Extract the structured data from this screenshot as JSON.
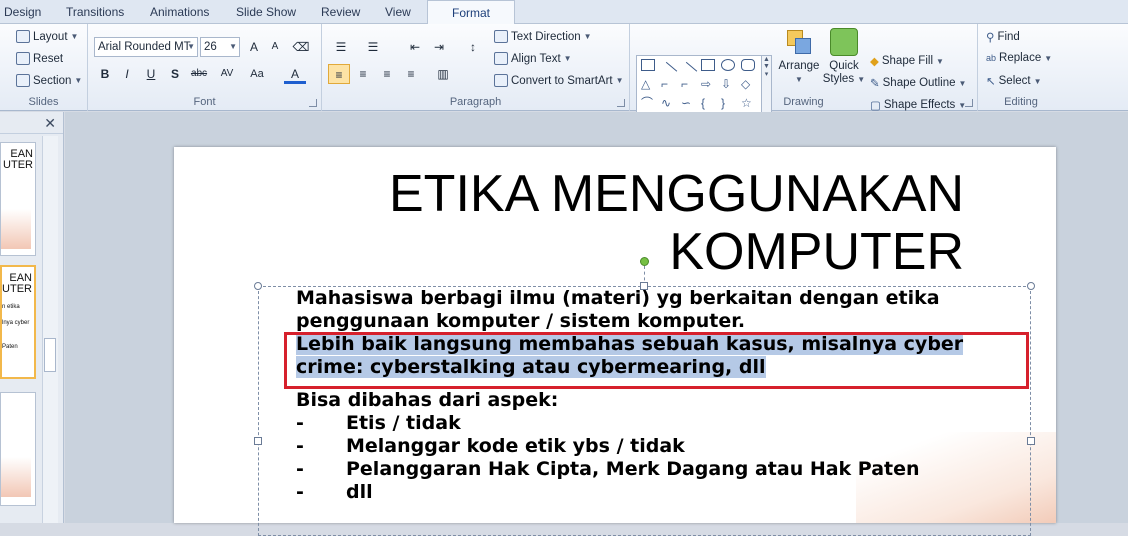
{
  "tabs": [
    "Design",
    "Transitions",
    "Animations",
    "Slide Show",
    "Review",
    "View",
    "Format"
  ],
  "active_tab": "Format",
  "ribbon": {
    "slides": {
      "label": "Slides",
      "layout": "Layout",
      "reset": "Reset",
      "section": "Section"
    },
    "font": {
      "label": "Font",
      "font_name": "Arial Rounded MT",
      "font_size": "26"
    },
    "paragraph": {
      "label": "Paragraph",
      "text_direction": "Text Direction",
      "align_text": "Align Text",
      "convert_smartart": "Convert to SmartArt"
    },
    "drawing": {
      "label": "Drawing",
      "arrange": "Arrange",
      "quick_styles_1": "Quick",
      "quick_styles_2": "Styles",
      "shape_fill": "Shape Fill",
      "shape_outline": "Shape Outline",
      "shape_effects": "Shape Effects"
    },
    "editing": {
      "label": "Editing",
      "find": "Find",
      "replace": "Replace",
      "select": "Select"
    }
  },
  "thumbs": {
    "t1_a": "EAN",
    "t1_b": "UTER",
    "t2_a": "EAN",
    "t2_b": "UTER",
    "t2_c": "n etika",
    "t2_d": "lnya cyber",
    "t2_e": "Paten"
  },
  "slide": {
    "title_line1": "ETIKA MENGGUNAKAN",
    "title_line2": "KOMPUTER",
    "para1": "Mahasiswa berbagi ilmu (materi) yg berkaitan dengan etika penggunaan komputer / sistem komputer.",
    "para2": "Lebih baik langsung membahas sebuah kasus, misalnya cyber crime: cyberstalking atau cybermearing, dll",
    "para3": "Bisa dibahas dari aspek:",
    "bullet_marker": "-",
    "bullets": [
      "Etis / tidak",
      "Melanggar kode etik ybs / tidak",
      "Pelanggaran Hak Cipta, Merk Dagang atau Hak Paten",
      "dll"
    ]
  },
  "colors": {
    "highlight": "#b5c9e6",
    "annotation": "#d6202c"
  }
}
